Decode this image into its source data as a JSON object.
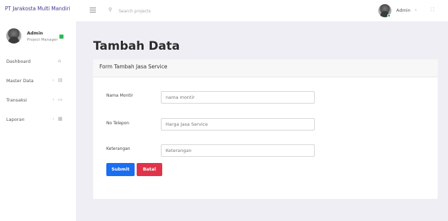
{
  "app": {
    "brand": "PT Jarakosta Multi Mandiri"
  },
  "profile": {
    "name": "Admin",
    "role": "Project Manager",
    "status_color": "#2dbb57"
  },
  "sidebar": {
    "items": [
      {
        "label": "Dashboard",
        "icon": "home-icon",
        "has_submenu": false
      },
      {
        "label": "Master Data",
        "icon": "database-icon",
        "has_submenu": true
      },
      {
        "label": "Transaksi",
        "icon": "cart-icon",
        "has_submenu": true
      },
      {
        "label": "Laporan",
        "icon": "document-icon",
        "has_submenu": true
      }
    ]
  },
  "topbar": {
    "search_placeholder": "Search projects",
    "user_label": "Admin"
  },
  "main": {
    "page_title": "Tambah Data",
    "form": {
      "title": "Form Tambah Jasa Service",
      "fields": [
        {
          "label": "Nama Montir",
          "placeholder": "nama montir",
          "value": ""
        },
        {
          "label": "No Telepon",
          "placeholder": "Harga Jasa Service",
          "value": ""
        },
        {
          "label": "Keterangan",
          "placeholder": "Keterangan",
          "value": ""
        }
      ],
      "submit_label": "Submit",
      "cancel_label": "Batal"
    }
  },
  "colors": {
    "brand": "#4b3f8f",
    "submit": "#1a6ef0",
    "cancel": "#e0334a",
    "background": "#f0eef5"
  }
}
